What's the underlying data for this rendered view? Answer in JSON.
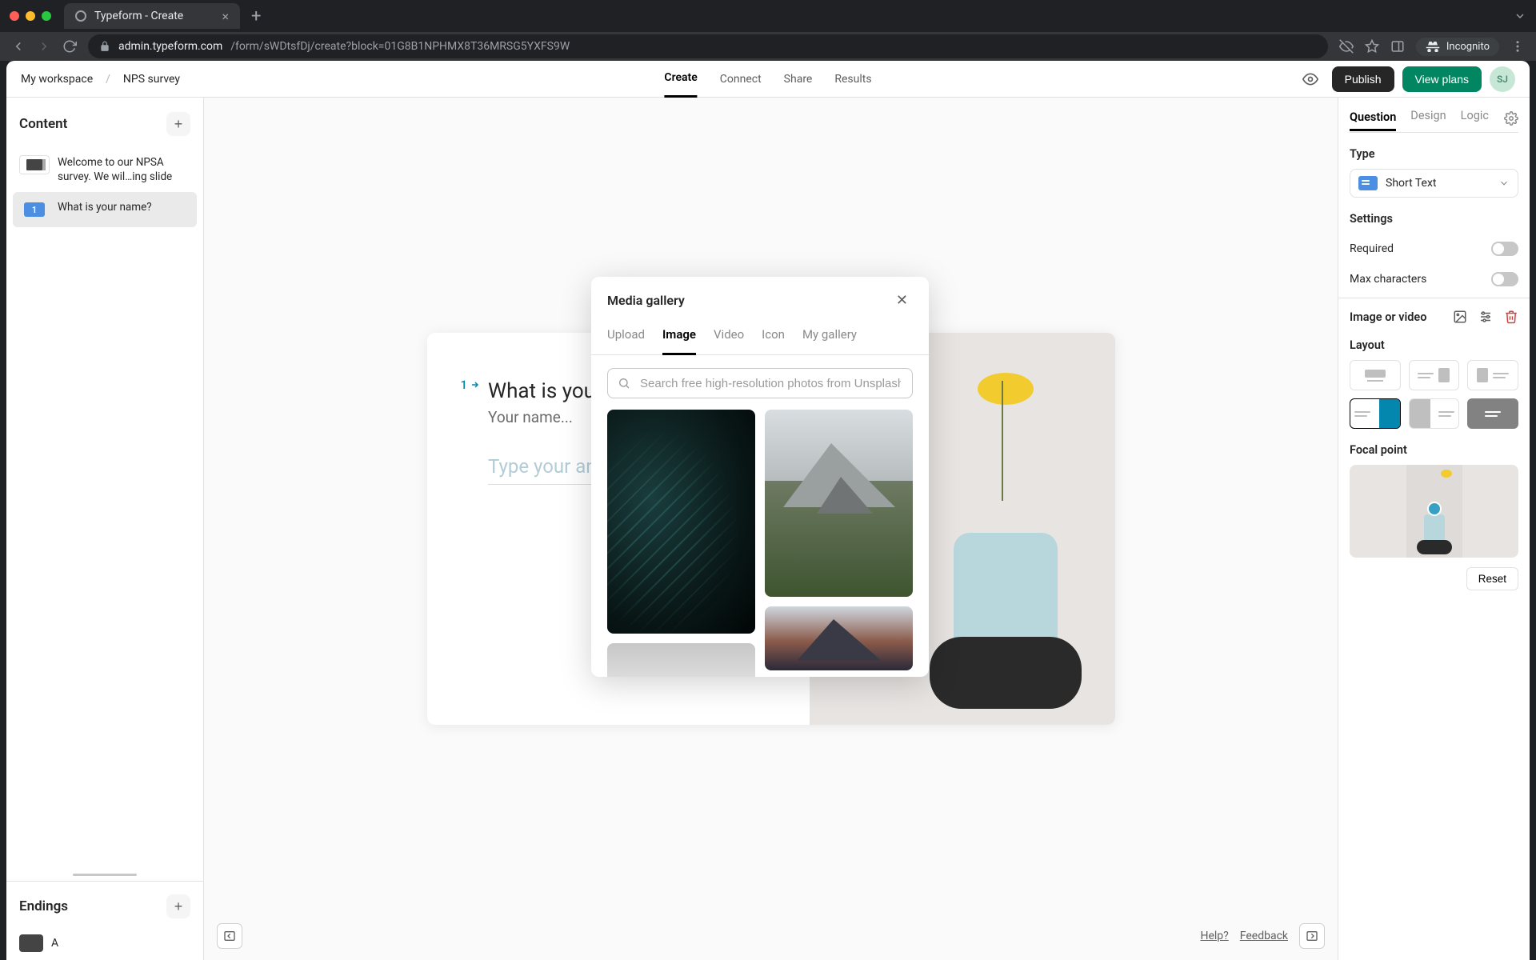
{
  "browser": {
    "tab_title": "Typeform - Create",
    "url_host": "admin.typeform.com",
    "url_path": "/form/sWDtsfDj/create?block=01G8B1NPHMX8T36MRSG5YXFS9W",
    "incognito_label": "Incognito"
  },
  "breadcrumbs": {
    "workspace": "My workspace",
    "form": "NPS survey"
  },
  "top_tabs": {
    "create": "Create",
    "connect": "Connect",
    "share": "Share",
    "results": "Results"
  },
  "top_buttons": {
    "publish": "Publish",
    "view_plans": "View plans",
    "avatar": "SJ"
  },
  "left_panel": {
    "content_title": "Content",
    "items": [
      {
        "label": "Welcome to our NPSA survey. We wil…ing slide"
      },
      {
        "number": "1",
        "label": "What is your name?"
      }
    ],
    "endings_title": "Endings",
    "ending_letter": "A"
  },
  "canvas": {
    "question_number": "1",
    "question_title": "What is your name",
    "question_desc": "Your name...",
    "answer_placeholder": "Type your ans"
  },
  "canvas_footer": {
    "help": "Help?",
    "feedback": "Feedback"
  },
  "right_panel": {
    "tabs": {
      "question": "Question",
      "design": "Design",
      "logic": "Logic"
    },
    "type_label": "Type",
    "type_value": "Short Text",
    "settings_label": "Settings",
    "required_label": "Required",
    "maxchars_label": "Max characters",
    "iov_label": "Image or video",
    "layout_label": "Layout",
    "focal_label": "Focal point",
    "reset_label": "Reset"
  },
  "modal": {
    "title": "Media gallery",
    "tabs": {
      "upload": "Upload",
      "image": "Image",
      "video": "Video",
      "icon": "Icon",
      "mygallery": "My gallery"
    },
    "search_placeholder": "Search free high-resolution photos from Unsplash"
  }
}
